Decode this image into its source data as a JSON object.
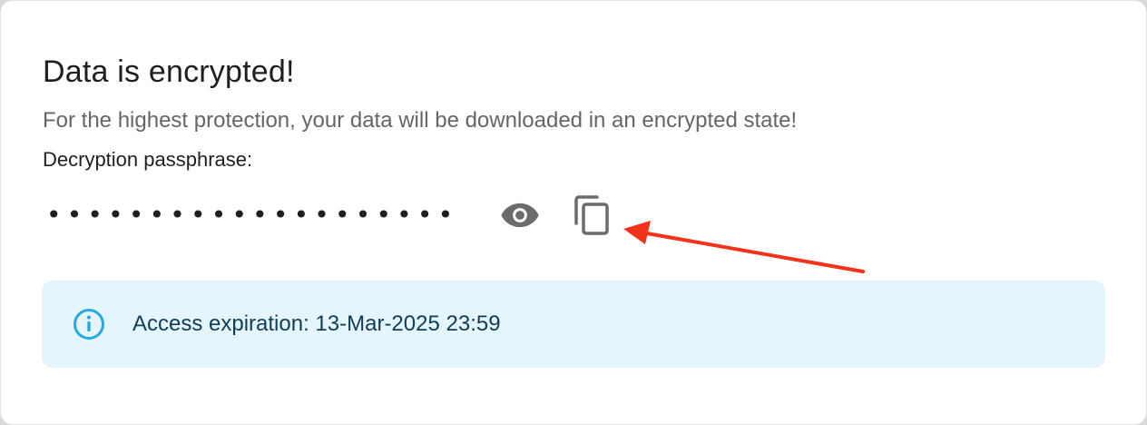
{
  "dialog": {
    "title": "Data is encrypted!",
    "subtitle": "For the highest protection, your data will be downloaded in an encrypted state!",
    "passphrase_label": "Decryption passphrase:",
    "passphrase_masked": "••••••••••••••••••••",
    "show_icon": "eye-icon",
    "copy_icon": "copy-icon"
  },
  "info": {
    "icon": "info-icon",
    "text": "Access expiration: 13-Mar-2025 23:59"
  },
  "colors": {
    "annotation_arrow": "#f2321b",
    "info_background": "#e5f5fc",
    "info_icon": "#2aa8e0",
    "info_text": "#0f3d57",
    "icon_gray": "#6b6b6b"
  }
}
